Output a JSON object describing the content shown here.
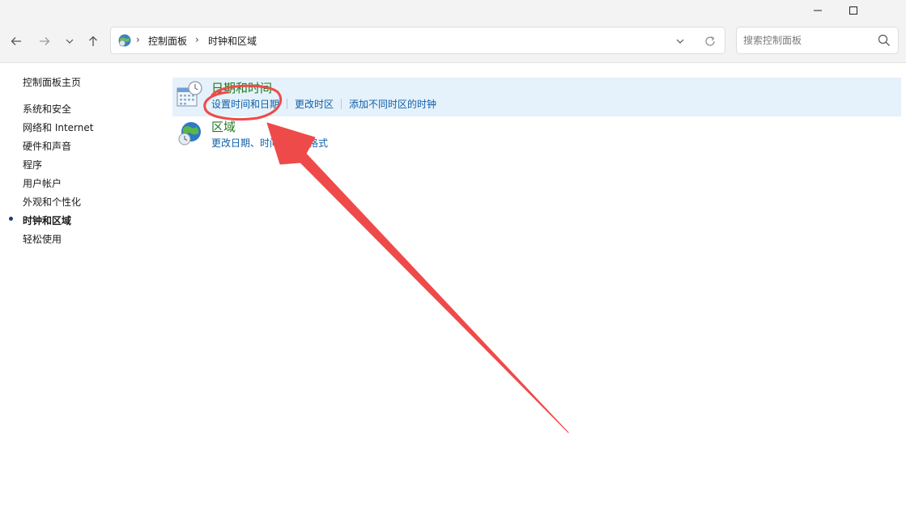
{
  "window": {
    "minimize_label": "Minimize",
    "maximize_label": "Maximize"
  },
  "nav": {
    "breadcrumbs": [
      "控制面板",
      "时钟和区域"
    ]
  },
  "search": {
    "placeholder": "搜索控制面板"
  },
  "sidebar": {
    "items": [
      {
        "label": "控制面板主页",
        "active": false
      },
      {
        "label": "系统和安全",
        "active": false
      },
      {
        "label": "网络和 Internet",
        "active": false
      },
      {
        "label": "硬件和声音",
        "active": false
      },
      {
        "label": "程序",
        "active": false
      },
      {
        "label": "用户帐户",
        "active": false
      },
      {
        "label": "外观和个性化",
        "active": false
      },
      {
        "label": "时钟和区域",
        "active": true
      },
      {
        "label": "轻松使用",
        "active": false
      }
    ]
  },
  "main": {
    "categories": [
      {
        "title": "日期和时间",
        "links": [
          "设置时间和日期",
          "更改时区",
          "添加不同时区的时钟"
        ]
      },
      {
        "title": "区域",
        "links": [
          "更改日期、时间或数字格式"
        ]
      }
    ]
  },
  "colors": {
    "category_title": "#1e7b1e",
    "link": "#0f5fa8",
    "highlight_bg": "#e5f1fb",
    "annotation_red": "#ef4a4a"
  }
}
